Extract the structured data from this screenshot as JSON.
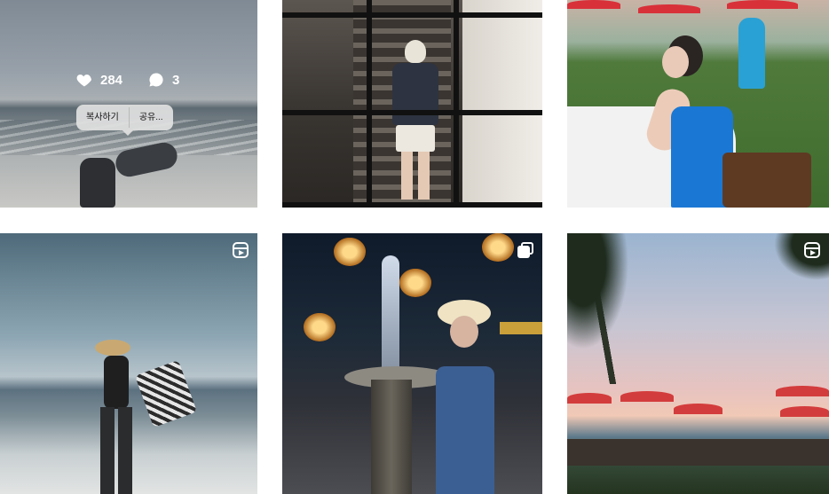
{
  "grid": {
    "posts": [
      {
        "type": "photo",
        "hover": true
      },
      {
        "type": "photo"
      },
      {
        "type": "photo"
      },
      {
        "type": "reel",
        "icon": "reel-icon"
      },
      {
        "type": "carousel",
        "icon": "carousel-icon"
      },
      {
        "type": "reel",
        "icon": "reel-icon"
      }
    ]
  },
  "hover_overlay": {
    "likes": "284",
    "comments": "3",
    "like_icon": "heart-icon",
    "comment_icon": "comment-icon"
  },
  "context_menu": {
    "copy_label": "복사하기",
    "share_label": "공유..."
  },
  "colors": {
    "overlay_text": "#ffffff",
    "menu_bg": "#e1e1e1"
  }
}
